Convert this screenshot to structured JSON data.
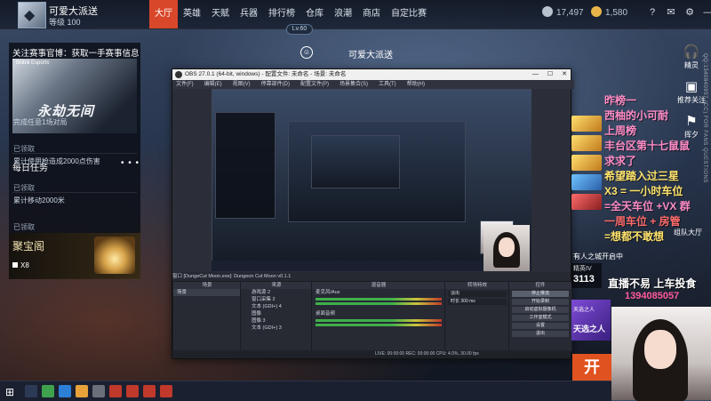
{
  "player": {
    "name": "可爱大派送",
    "level": "等级 100"
  },
  "nav": {
    "tabs": [
      "大厅",
      "英雄",
      "天赋",
      "兵器",
      "排行榜",
      "仓库",
      "浪潮",
      "商店",
      "自定比赛"
    ],
    "active": 0
  },
  "currency": {
    "stat1": "17,497",
    "stat2": "1,580"
  },
  "top_icons": [
    "help-icon",
    "mail-icon",
    "settings-icon",
    "minimize-icon",
    "close-icon"
  ],
  "level_chip": "Lv.60",
  "center_nick": "可爱大派送",
  "left_panel": {
    "follow_title": "关注赛事官博：获取一手赛事信息",
    "banner_brand": "Bilibili Esports",
    "banner_title": "永劫无间",
    "daily_title": "每日任务",
    "daily_more": "• • •",
    "tasks": [
      {
        "text": "完成任意1场对局",
        "status": "已领取"
      },
      {
        "text": "累计使用枪造成2000点伤害",
        "status": "已领取"
      },
      {
        "text": "累计移动2000米",
        "status": "已领取"
      }
    ],
    "treasure_title": "聚宝阁",
    "treasure_count": "X8"
  },
  "obs": {
    "title": "OBS 27.0.1 (64-bit, windows) - 配置文件: 未命名 - 场景: 未命名",
    "menu": [
      "文件(F)",
      "编辑(E)",
      "视图(V)",
      "停靠部件(D)",
      "配置文件(P)",
      "场景集合(S)",
      "工具(T)",
      "帮助(H)"
    ],
    "status_bar": "窗口   [DungeCut Moon.exe]: Dungeon Cut Moon v0.1.1",
    "docks": {
      "scenes": "场景",
      "sources": "来源",
      "mixer": "混音器",
      "transitions": "转场特效",
      "controls": "控件"
    },
    "scene_items": [
      "场景"
    ],
    "source_items": [
      "游戏源 2",
      "窗口采集 2",
      "文本 (GDI+) 4",
      "图像",
      "图像 3",
      "文本 (GDI+) 3"
    ],
    "mixer_items": [
      "麦克风/Aux",
      "桌面音频"
    ],
    "transition_values": [
      "淡出",
      "时长  300 ms"
    ],
    "control_buttons": [
      "停止推流",
      "开始录制",
      "启动虚拟摄像机",
      "工作室模式",
      "设置",
      "退出"
    ],
    "bottom": "LIVE: 00:00:00    REC: 00:00:00    CPU: 4.0%, 30.00 fps"
  },
  "right_icons": [
    {
      "icon": "headphone-icon",
      "label": "精灵"
    },
    {
      "icon": "camera-icon",
      "label": "推荐关注"
    },
    {
      "icon": "flag-icon",
      "label": "挥夕"
    }
  ],
  "vertical_url": "QQ:1340840957 (CC) FOR FANS QUESTIONS",
  "danmaku": [
    {
      "text": "昨榜一",
      "color": "pink"
    },
    {
      "text": "西柚的小可耐",
      "color": "pink"
    },
    {
      "text": "上周榜",
      "color": "pink"
    },
    {
      "text": "丰台区第十七鼠鼠",
      "color": "pink"
    },
    {
      "text": "求求了",
      "color": "pink"
    },
    {
      "text": "希望踏入过三星",
      "color": "yellow"
    },
    {
      "text": "X3 = 一小时车位",
      "color": "yellow"
    },
    {
      "text": "=全天车位 +VX 群",
      "color": "pink"
    },
    {
      "text": "一周车位 + 房管",
      "color": "red"
    },
    {
      "text": "=想都不敢想",
      "color": "yellow"
    }
  ],
  "side_labels": {
    "recv": "有人之城开启中",
    "level_tag": "精英IV",
    "level_num": "3113",
    "slogan": "直播不易 上车投食",
    "qq": "1394085057",
    "purple1": "天选之人",
    "purple2": "天选之人",
    "orange": "开",
    "match_label": "组队大厅"
  }
}
